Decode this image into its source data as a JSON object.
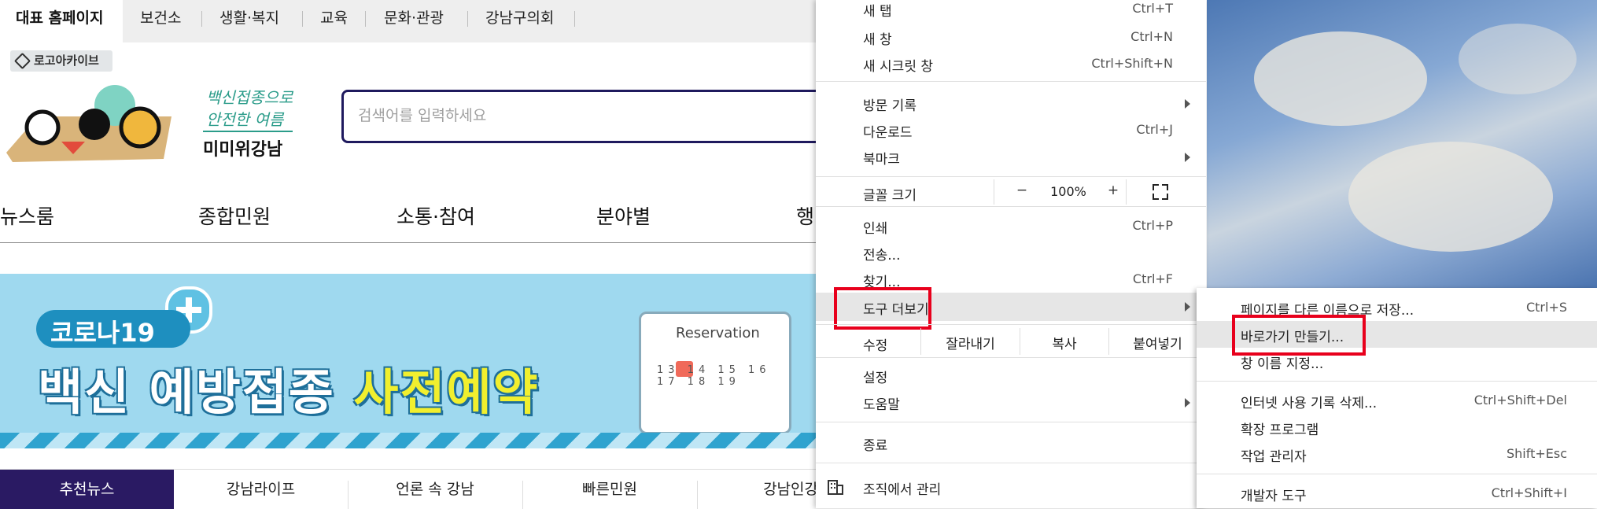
{
  "topbar": {
    "tabs": [
      "대표 홈페이지",
      "보건소",
      "생활·복지",
      "교육",
      "문화·관광",
      "강남구의회"
    ]
  },
  "logo_archive": "로고아카이브",
  "slogan": {
    "line1": "백신접종으로",
    "line2": "안전한 여름",
    "line3": "미미위강남"
  },
  "search": {
    "placeholder": "검색어를 입력하세요"
  },
  "nav": [
    "뉴스룸",
    "종합민원",
    "소통·참여",
    "분야별",
    "행"
  ],
  "banner": {
    "badge": "코로나19",
    "title_white": "백신 예방접종 ",
    "title_yellow": "사전예약",
    "calendar_title": "Reservation",
    "calendar_days": "13 14 15 16 17 18 19"
  },
  "bottom_tabs": [
    "추천뉴스",
    "강남라이프",
    "언론 속 강남",
    "빠른민원",
    "강남인강"
  ],
  "menu": {
    "new_tab": "새 탭",
    "new_tab_sc": "Ctrl+T",
    "new_window": "새 창",
    "new_window_sc": "Ctrl+N",
    "incognito": "새 시크릿 창",
    "incognito_sc": "Ctrl+Shift+N",
    "history": "방문 기록",
    "downloads": "다운로드",
    "downloads_sc": "Ctrl+J",
    "bookmarks": "북마크",
    "font_size": "글꼴 크기",
    "zoom_minus": "−",
    "zoom_value": "100%",
    "zoom_plus": "+",
    "print": "인쇄",
    "print_sc": "Ctrl+P",
    "cast": "전송...",
    "find": "찾기...",
    "find_sc": "Ctrl+F",
    "more_tools": "도구 더보기",
    "edit": "수정",
    "cut": "잘라내기",
    "copy": "복사",
    "paste": "붙여넣기",
    "settings": "설정",
    "help": "도움말",
    "exit": "종료",
    "managed": "조직에서 관리"
  },
  "submenu": {
    "save_as": "페이지를 다른 이름으로 저장...",
    "save_as_sc": "Ctrl+S",
    "create_shortcut": "바로가기 만들기...",
    "name_window": "창 이름 지정...",
    "clear_data": "인터넷 사용 기록 삭제...",
    "clear_data_sc": "Ctrl+Shift+Del",
    "extensions": "확장 프로그램",
    "task_manager": "작업 관리자",
    "task_manager_sc": "Shift+Esc",
    "dev_tools": "개발자 도구",
    "dev_tools_sc": "Ctrl+Shift+I"
  },
  "colors": {
    "highlight_box": "#e8001c",
    "brand_purple": "#2a1a63",
    "search_border": "#1f1a5e"
  }
}
